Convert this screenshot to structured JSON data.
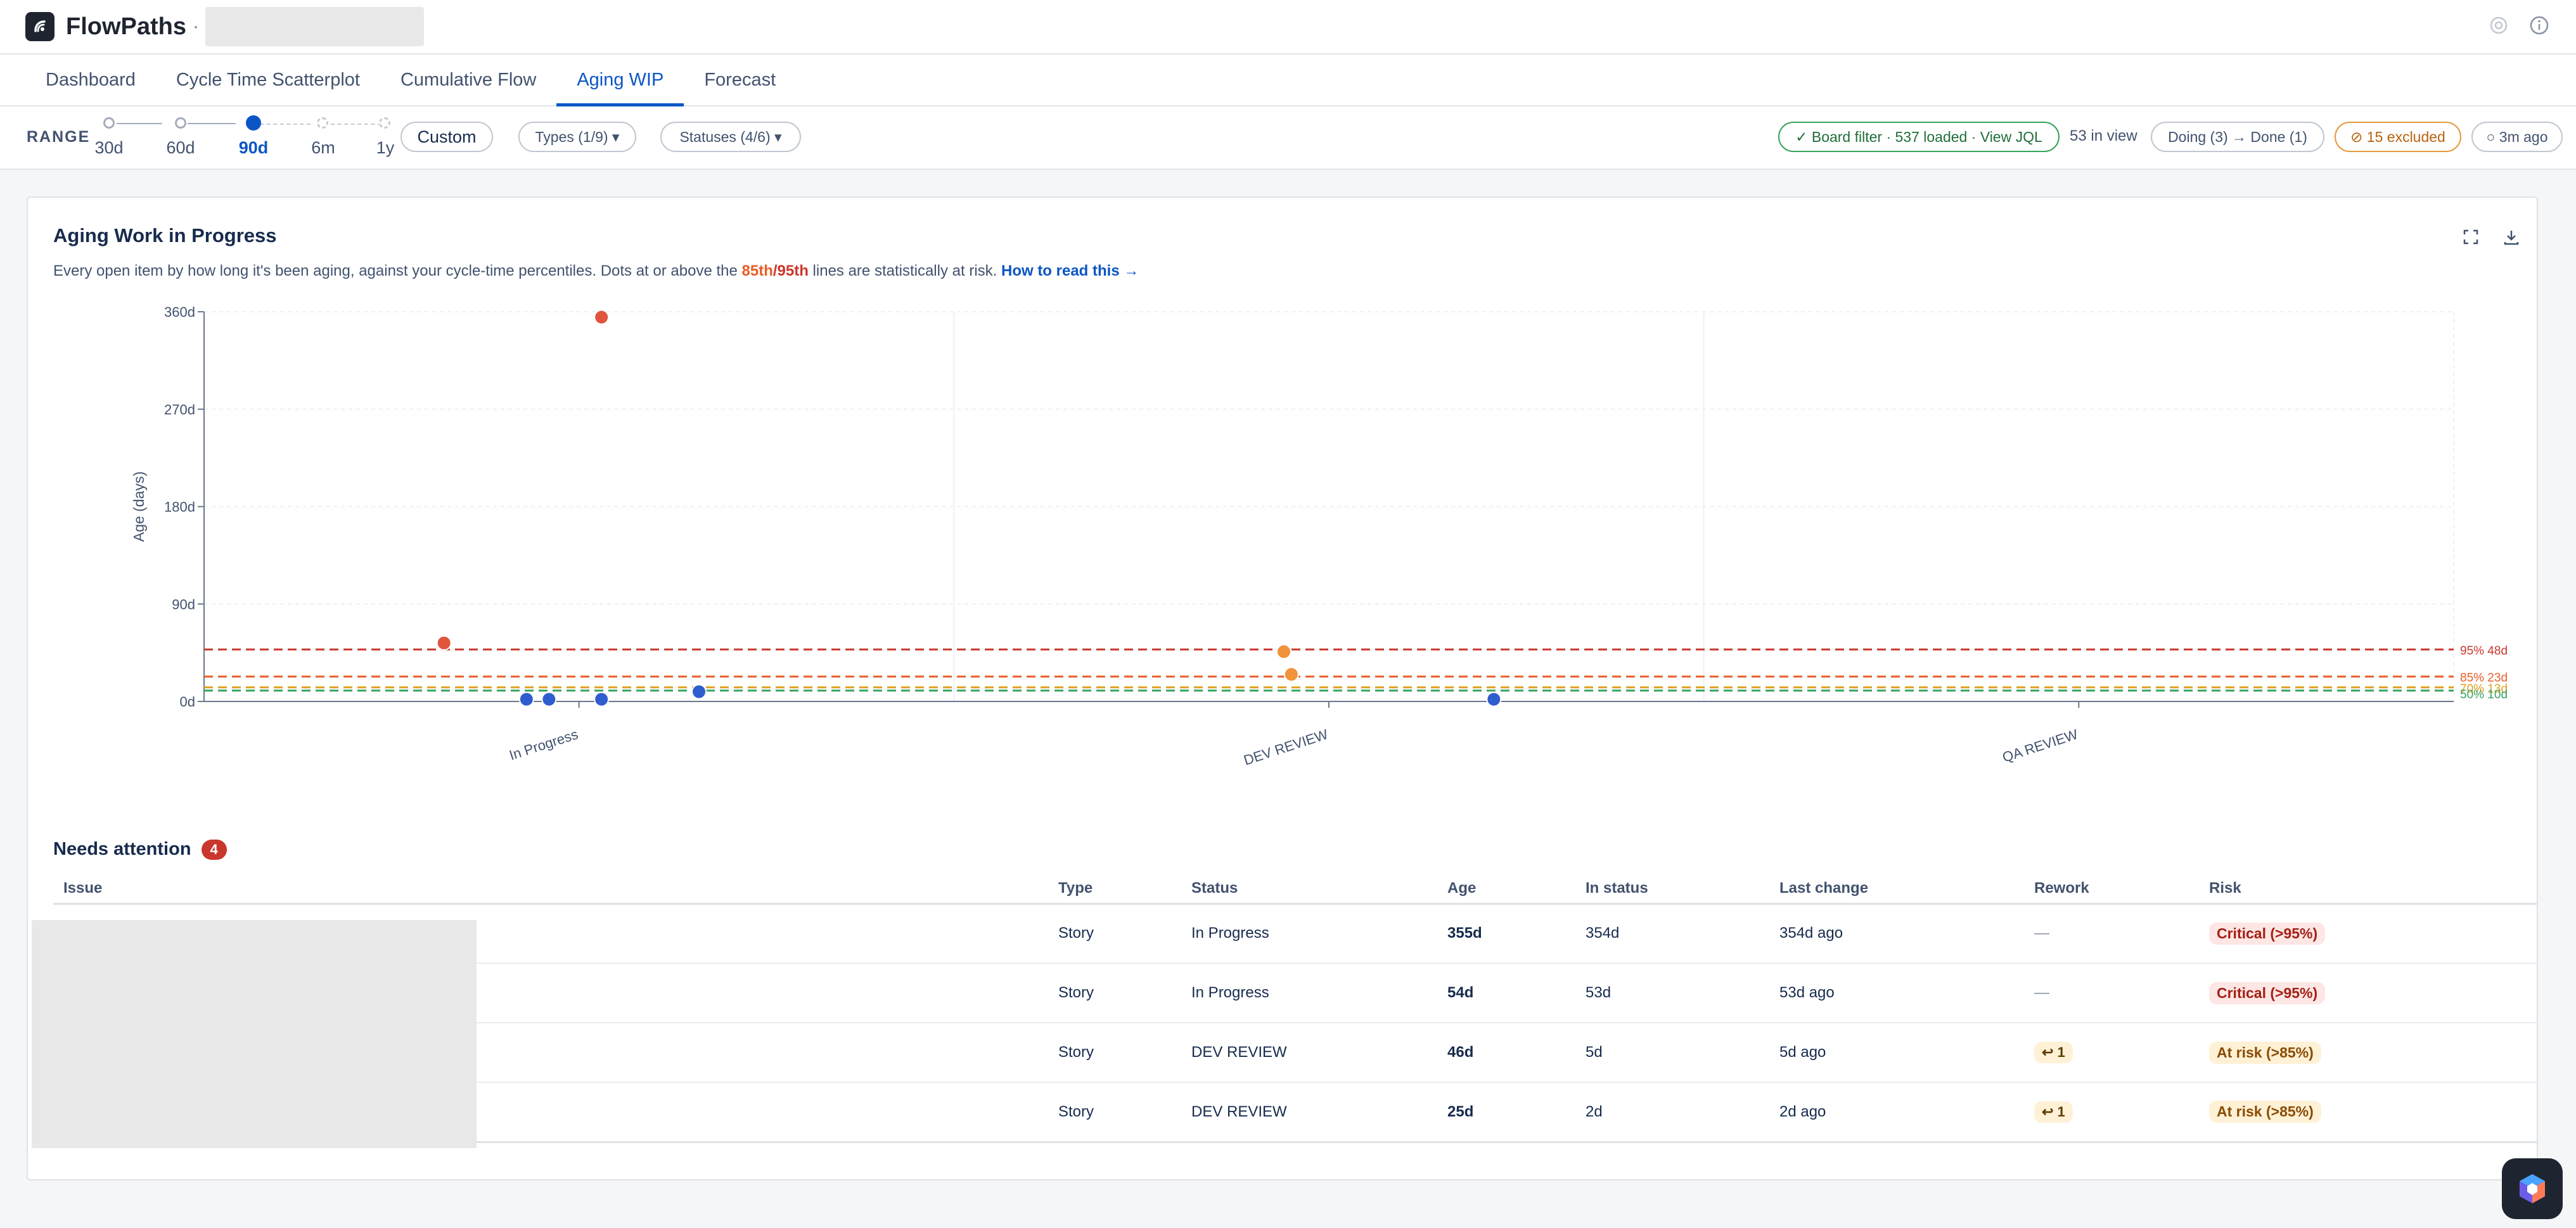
{
  "app": {
    "name": "FlowPaths",
    "separator": "·"
  },
  "tabs": [
    {
      "label": "Dashboard",
      "active": false
    },
    {
      "label": "Cycle Time Scatterplot",
      "active": false
    },
    {
      "label": "Cumulative Flow",
      "active": false
    },
    {
      "label": "Aging WIP",
      "active": true
    },
    {
      "label": "Forecast",
      "active": false
    }
  ],
  "filters": {
    "range_label": "RANGE",
    "range_options": [
      {
        "label": "30d",
        "selected": false
      },
      {
        "label": "60d",
        "selected": false
      },
      {
        "label": "90d",
        "selected": true
      },
      {
        "label": "6m",
        "selected": false
      },
      {
        "label": "1y",
        "selected": false
      }
    ],
    "custom_label": "Custom",
    "types_label": "Types (1/9) ▾",
    "statuses_label": "Statuses (4/6) ▾",
    "board_filter": "✓ Board filter · 537 loaded · View JQL",
    "in_view": "53 in view",
    "doing_done": "Doing (3) → Done (1)",
    "excluded": "⊘ 15 excluded",
    "updated": "○ 3m ago"
  },
  "card": {
    "title": "Aging Work in Progress",
    "subtitle_pre": "Every open item by how long it's been aging, against your cycle-time percentiles. Dots at or above the ",
    "p85": "85th",
    "slash": "/",
    "p95": "95th",
    "subtitle_post": " lines are statistically at risk. ",
    "howto": "How to read this →"
  },
  "chart_data": {
    "type": "scatter",
    "ylabel": "Age (days)",
    "ylim": [
      0,
      360
    ],
    "yticks": [
      "0d",
      "90d",
      "180d",
      "270d",
      "360d"
    ],
    "ytick_values": [
      0,
      90,
      180,
      270,
      360
    ],
    "categories": [
      "In Progress",
      "DEV REVIEW",
      "QA REVIEW"
    ],
    "percentiles": [
      {
        "label": "95% 48d",
        "value": 48,
        "color": "#c9372c"
      },
      {
        "label": "85% 23d",
        "value": 23,
        "color": "#e85d26"
      },
      {
        "label": "70% 13d",
        "value": 13,
        "color": "#e0a020"
      },
      {
        "label": "50% 10d",
        "value": 10,
        "color": "#36a35c"
      }
    ],
    "points": [
      {
        "category": "In Progress",
        "offset": -0.18,
        "age": 54,
        "risk": "critical"
      },
      {
        "category": "In Progress",
        "offset": -0.07,
        "age": 2,
        "risk": "ok"
      },
      {
        "category": "In Progress",
        "offset": -0.04,
        "age": 2,
        "risk": "ok"
      },
      {
        "category": "In Progress",
        "offset": 0.03,
        "age": 2,
        "risk": "ok"
      },
      {
        "category": "In Progress",
        "offset": 0.03,
        "age": 355,
        "risk": "critical"
      },
      {
        "category": "In Progress",
        "offset": 0.16,
        "age": 9,
        "risk": "ok"
      },
      {
        "category": "DEV REVIEW",
        "offset": -0.06,
        "age": 46,
        "risk": "warn"
      },
      {
        "category": "DEV REVIEW",
        "offset": -0.05,
        "age": 25,
        "risk": "warn"
      },
      {
        "category": "DEV REVIEW",
        "offset": 0.22,
        "age": 2,
        "risk": "ok"
      }
    ],
    "colors": {
      "critical": "#e0553d",
      "warn": "#f0933a",
      "ok": "#2f5ccf"
    }
  },
  "attention": {
    "title": "Needs attention",
    "count": "4",
    "columns": [
      "Issue",
      "Type",
      "Status",
      "Age",
      "In status",
      "Last change",
      "Rework",
      "Risk"
    ],
    "rows": [
      {
        "type": "Story",
        "status": "In Progress",
        "age": "355d",
        "in_status": "354d",
        "last_change": "354d ago",
        "rework": "—",
        "risk": "Critical (>95%)",
        "risk_level": "crit"
      },
      {
        "type": "Story",
        "status": "In Progress",
        "age": "54d",
        "in_status": "53d",
        "last_change": "53d ago",
        "rework": "—",
        "risk": "Critical (>95%)",
        "risk_level": "crit"
      },
      {
        "type": "Story",
        "status": "DEV REVIEW",
        "age": "46d",
        "in_status": "5d",
        "last_change": "5d ago",
        "rework": "↩ 1",
        "risk": "At risk (>85%)",
        "risk_level": "warn"
      },
      {
        "type": "Story",
        "status": "DEV REVIEW",
        "age": "25d",
        "in_status": "2d",
        "last_change": "2d ago",
        "rework": "↩ 1",
        "risk": "At risk (>85%)",
        "risk_level": "warn"
      }
    ]
  }
}
